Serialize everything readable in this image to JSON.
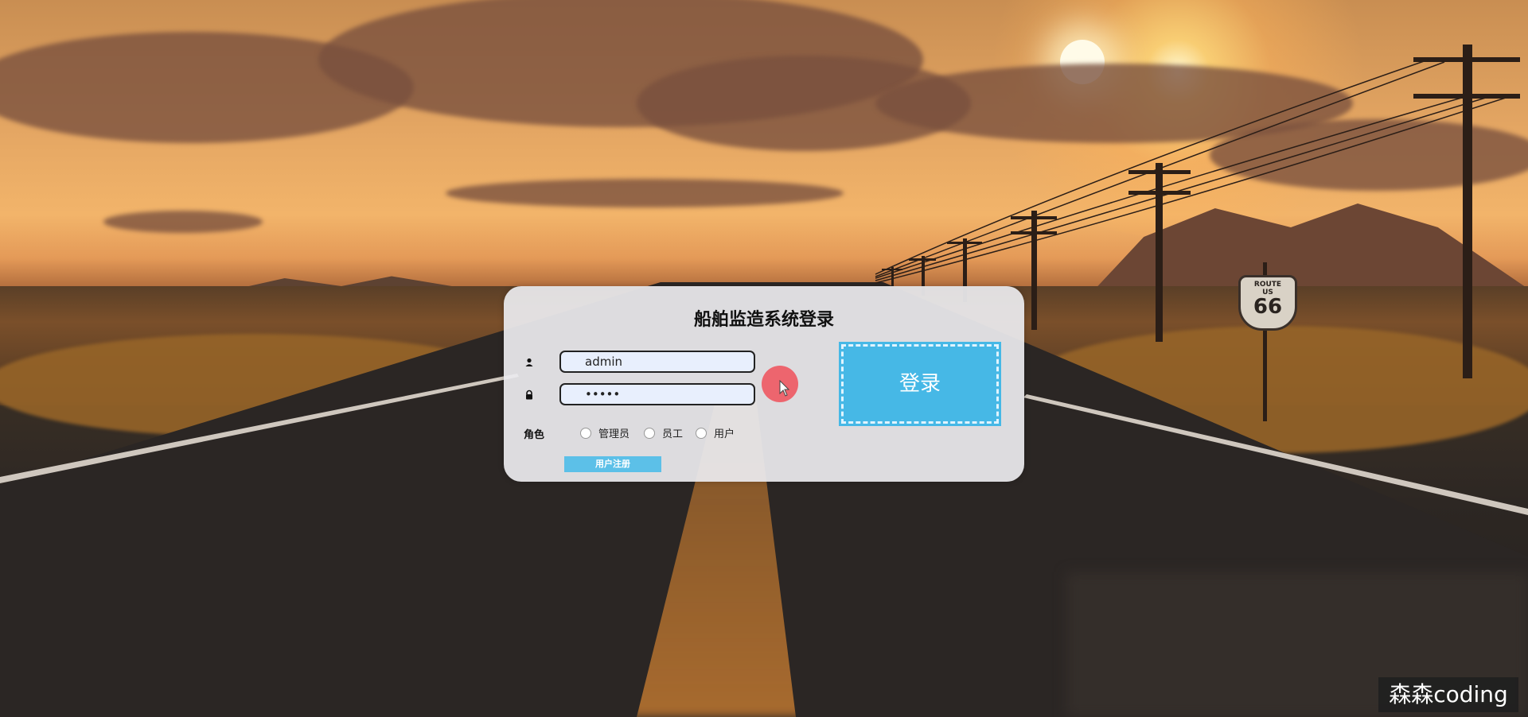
{
  "login": {
    "title": "船舶监造系统登录",
    "username_value": "admin",
    "password_mask": "•••••",
    "role_label": "角色",
    "roles": [
      {
        "label": "管理员",
        "selected": false
      },
      {
        "label": "员工",
        "selected": false
      },
      {
        "label": "用户",
        "selected": false
      }
    ],
    "login_button": "登录",
    "register_button": "用户注册"
  },
  "background": {
    "road_sign_top": "ROUTE",
    "road_sign_middle": "US",
    "road_sign_number": "66"
  },
  "watermark": "森森coding",
  "colors": {
    "login_button": "#46b8e6",
    "register_button": "#5cc0e8",
    "panel": "#ebebee",
    "input_fill": "#e8effd",
    "cursor_highlight": "#f0505a"
  }
}
